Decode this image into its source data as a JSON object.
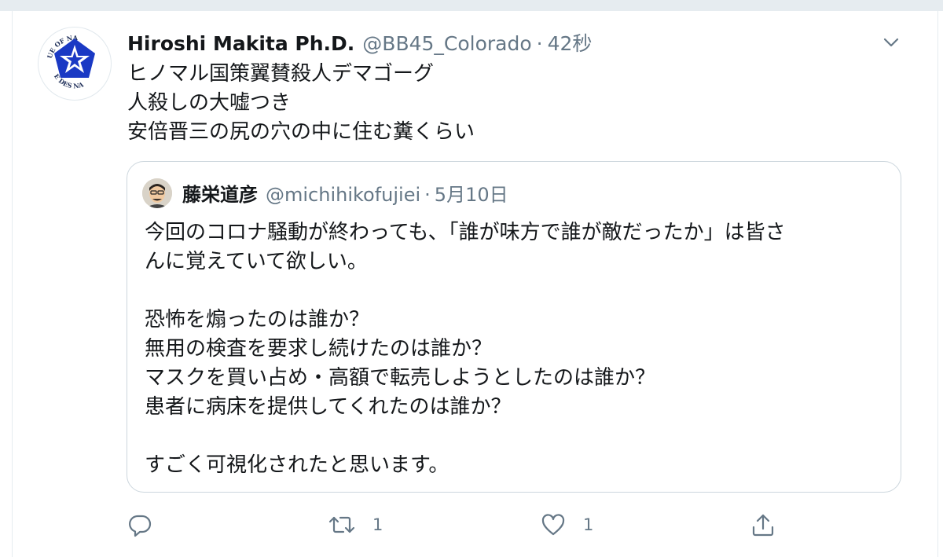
{
  "tweet": {
    "display_name": "Hiroshi Makita Ph.D.",
    "handle": "@BB45_Colorado",
    "separator": "·",
    "timestamp": "42秒",
    "avatar_text_top": "UE OF NA",
    "avatar_text_bottom": "E DES NA",
    "lines": [
      "ヒノマル国策翼賛殺人デマゴーグ",
      "人殺しの大嘘つき",
      "安倍晋三の尻の穴の中に住む糞くらい"
    ]
  },
  "quote": {
    "display_name": "藤栄道彦",
    "handle": "@michihikofujiei",
    "separator": "·",
    "timestamp": "5月10日",
    "lines": [
      "今回のコロナ騒動が終わっても、「誰が味方で誰が敵だったか」は皆さ",
      "んに覚えていて欲しい。",
      "",
      "恐怖を煽ったのは誰か？",
      "無用の検査を要求し続けたのは誰か？",
      "マスクを買い占め・高額で転売しようとしたのは誰か？",
      "患者に病床を提供してくれたのは誰か？",
      "",
      "すごく可視化されたと思います。"
    ]
  },
  "actions": {
    "retweet_count": "1",
    "like_count": "1"
  },
  "icons": {
    "caret": "chevron-down-icon",
    "reply": "reply-icon",
    "retweet": "retweet-icon",
    "like": "heart-icon",
    "share": "share-icon"
  },
  "colors": {
    "text": "#14171a",
    "secondary": "#657786",
    "border": "#ccd6dd",
    "logo_blue": "#1a39c4"
  }
}
